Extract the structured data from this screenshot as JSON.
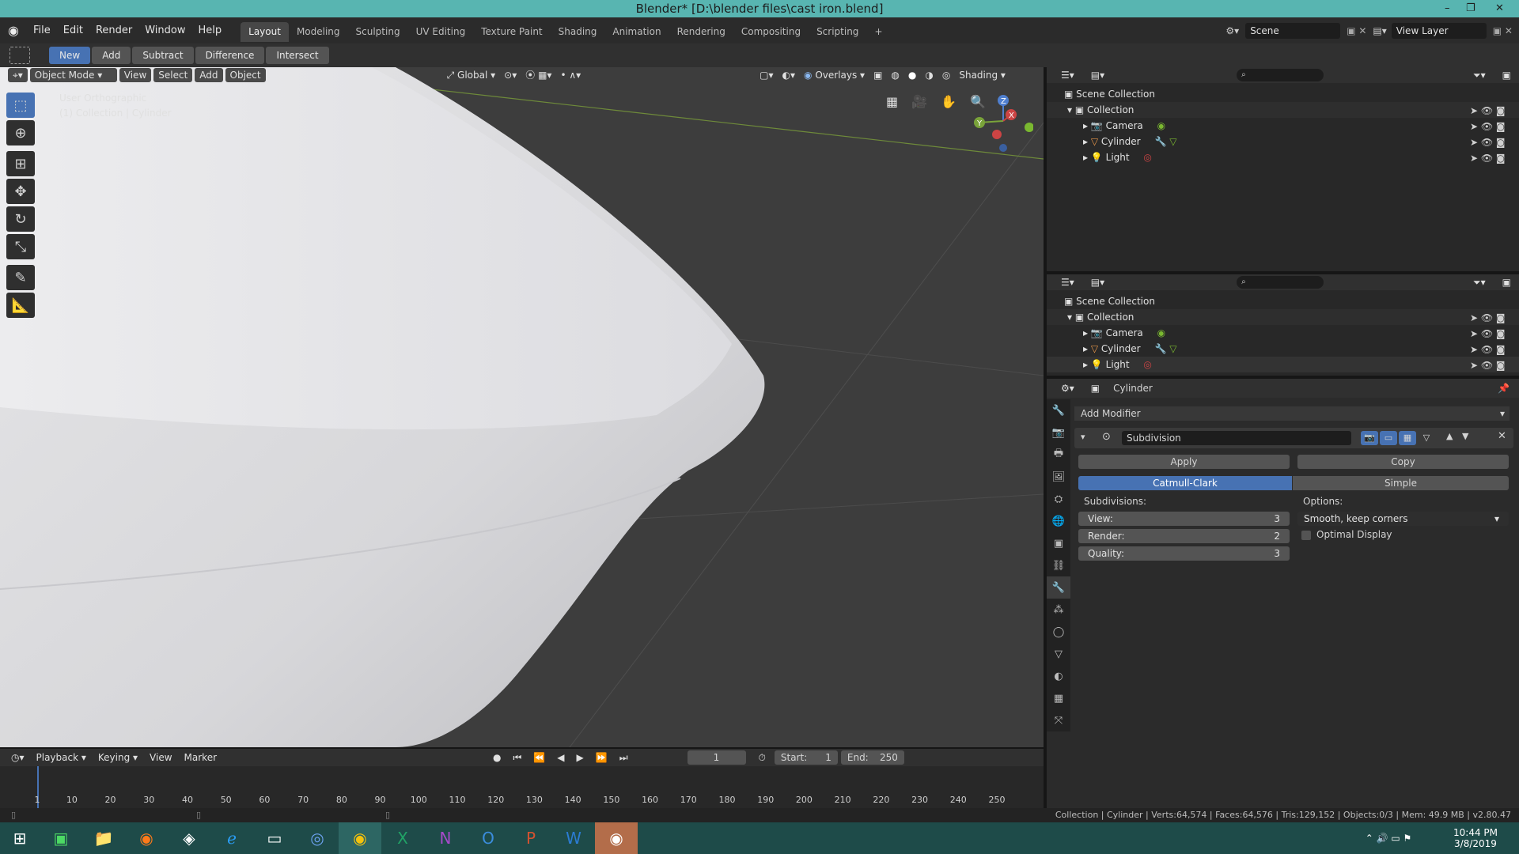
{
  "window": {
    "title": "Blender* [D:\\blender files\\cast iron.blend]",
    "min": "–",
    "max": "❐",
    "close": "✕"
  },
  "menu": [
    "File",
    "Edit",
    "Render",
    "Window",
    "Help"
  ],
  "workspaces": [
    "Layout",
    "Modeling",
    "Sculpting",
    "UV Editing",
    "Texture Paint",
    "Shading",
    "Animation",
    "Rendering",
    "Compositing",
    "Scripting"
  ],
  "workspace_add": "+",
  "scene": {
    "label": "Scene",
    "view_layer": "View Layer"
  },
  "booltool": {
    "new": "New",
    "add": "Add",
    "subtract": "Subtract",
    "difference": "Difference",
    "intersect": "Intersect"
  },
  "viewport_header": {
    "mode": "Object Mode",
    "view": "View",
    "select": "Select",
    "add": "Add",
    "object": "Object",
    "orientation": "Global",
    "overlays": "Overlays",
    "shading": "Shading"
  },
  "viewport_info": {
    "view_name": "User Orthographic",
    "context": "(1) Collection | Cylinder"
  },
  "gizmo": {
    "z": "Z",
    "y": "Y",
    "x": "X"
  },
  "outliner": {
    "root": "Scene Collection",
    "collection": "Collection",
    "items": [
      "Camera",
      "Cylinder",
      "Light"
    ]
  },
  "outliner2": {
    "root": "Scene Collection",
    "collection": "Collection",
    "items": [
      "Camera",
      "Cylinder",
      "Light"
    ]
  },
  "properties": {
    "object_name": "Cylinder",
    "add_modifier": "Add Modifier",
    "modifier_name": "Subdivision",
    "apply": "Apply",
    "copy": "Copy",
    "catmull": "Catmull-Clark",
    "simple": "Simple",
    "subdivisions_label": "Subdivisions:",
    "options_label": "Options:",
    "view_label": "View:",
    "view_value": "3",
    "render_label": "Render:",
    "render_value": "2",
    "quality_label": "Quality:",
    "quality_value": "3",
    "uv_smooth": "Smooth, keep corners",
    "optimal_display": "Optimal Display"
  },
  "timeline": {
    "playback": "Playback",
    "keying": "Keying",
    "view": "View",
    "marker": "Marker",
    "current_frame": "1",
    "start_label": "Start:",
    "start": "1",
    "end_label": "End:",
    "end": "250",
    "ticks": [
      "1",
      "10",
      "20",
      "30",
      "40",
      "50",
      "60",
      "70",
      "80",
      "90",
      "100",
      "110",
      "120",
      "130",
      "140",
      "150",
      "160",
      "170",
      "180",
      "190",
      "200",
      "210",
      "220",
      "230",
      "240",
      "250"
    ]
  },
  "status": {
    "text": "Collection | Cylinder | Verts:64,574 | Faces:64,576 | Tris:129,152 | Objects:0/3 | Mem: 49.9 MB | v2.80.47"
  },
  "clock": {
    "time": "10:44 PM",
    "date": "3/8/2019"
  },
  "colors": {
    "accent": "#4772b3",
    "title_bg": "#58b5b1",
    "taskbar": "#1e4b49"
  }
}
